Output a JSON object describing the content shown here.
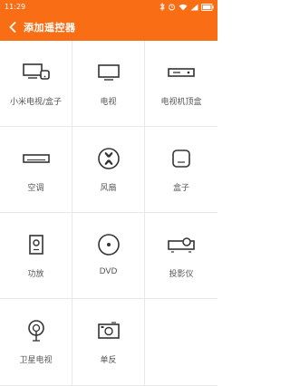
{
  "status_bar": {
    "time": "11:29"
  },
  "header": {
    "title": "添加遥控器",
    "accent_color": "#F96E14"
  },
  "devices": [
    {
      "label": "小米电视/盒子",
      "icon": "mi-tv-box-icon"
    },
    {
      "label": "电视",
      "icon": "tv-icon"
    },
    {
      "label": "电视机顶盒",
      "icon": "set-top-box-icon"
    },
    {
      "label": "空调",
      "icon": "air-conditioner-icon"
    },
    {
      "label": "风扇",
      "icon": "fan-icon"
    },
    {
      "label": "盒子",
      "icon": "box-icon"
    },
    {
      "label": "功放",
      "icon": "amplifier-icon"
    },
    {
      "label": "DVD",
      "icon": "dvd-icon"
    },
    {
      "label": "投影仪",
      "icon": "projector-icon"
    },
    {
      "label": "卫星电视",
      "icon": "satellite-tv-icon"
    },
    {
      "label": "单反",
      "icon": "dslr-camera-icon"
    }
  ]
}
